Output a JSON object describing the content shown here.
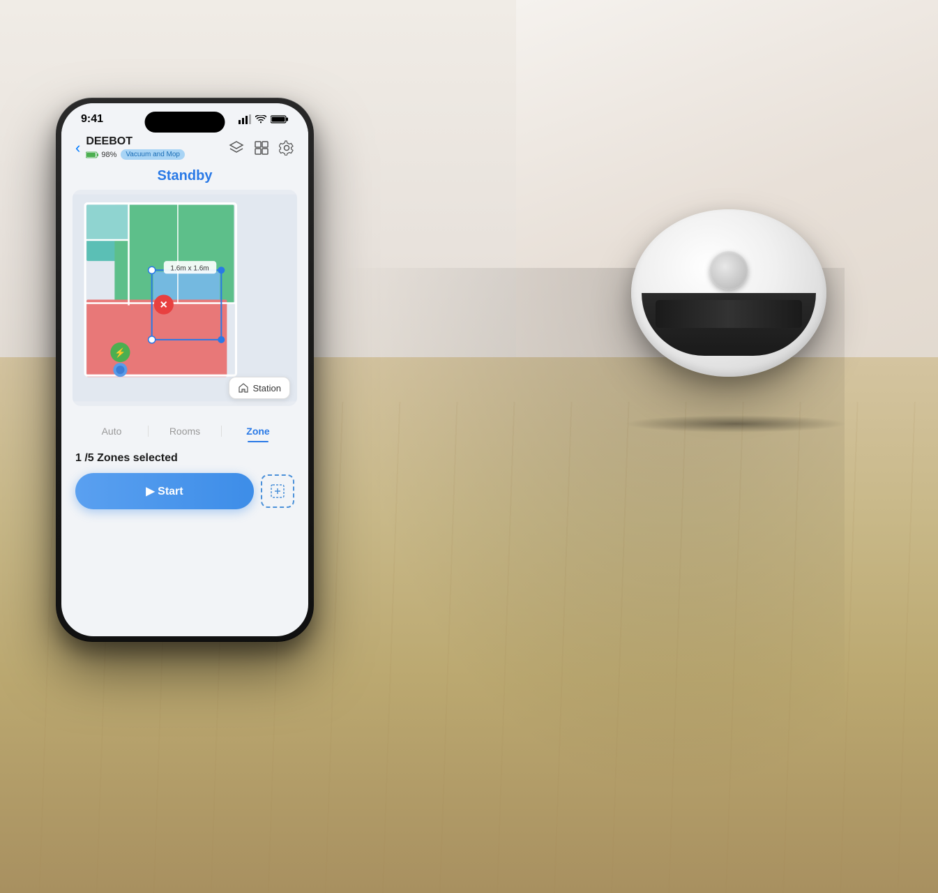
{
  "scene": {
    "background_desc": "Room with beige wall and wood floor, robot vacuum on floor"
  },
  "status_bar": {
    "time": "9:41",
    "battery_signal": "●●●●",
    "wifi": "wifi",
    "battery_full": "battery"
  },
  "nav": {
    "back_label": "‹",
    "device_name": "DEEBOT",
    "battery_pct": "98%",
    "mode_badge": "Vacuum and Mop",
    "layers_icon": "layers",
    "grid_icon": "grid",
    "settings_icon": "settings"
  },
  "map": {
    "standby_label": "Standby",
    "zone_size_label": "1.6m x 1.6m"
  },
  "station": {
    "label": "Station"
  },
  "tabs": [
    {
      "id": "auto",
      "label": "Auto",
      "active": false
    },
    {
      "id": "rooms",
      "label": "Rooms",
      "active": false
    },
    {
      "id": "zone",
      "label": "Zone",
      "active": true
    }
  ],
  "selection": {
    "label": "1 /5 Zones selected"
  },
  "actions": {
    "start_label": "▶ Start",
    "add_zone_label": "⊞"
  }
}
